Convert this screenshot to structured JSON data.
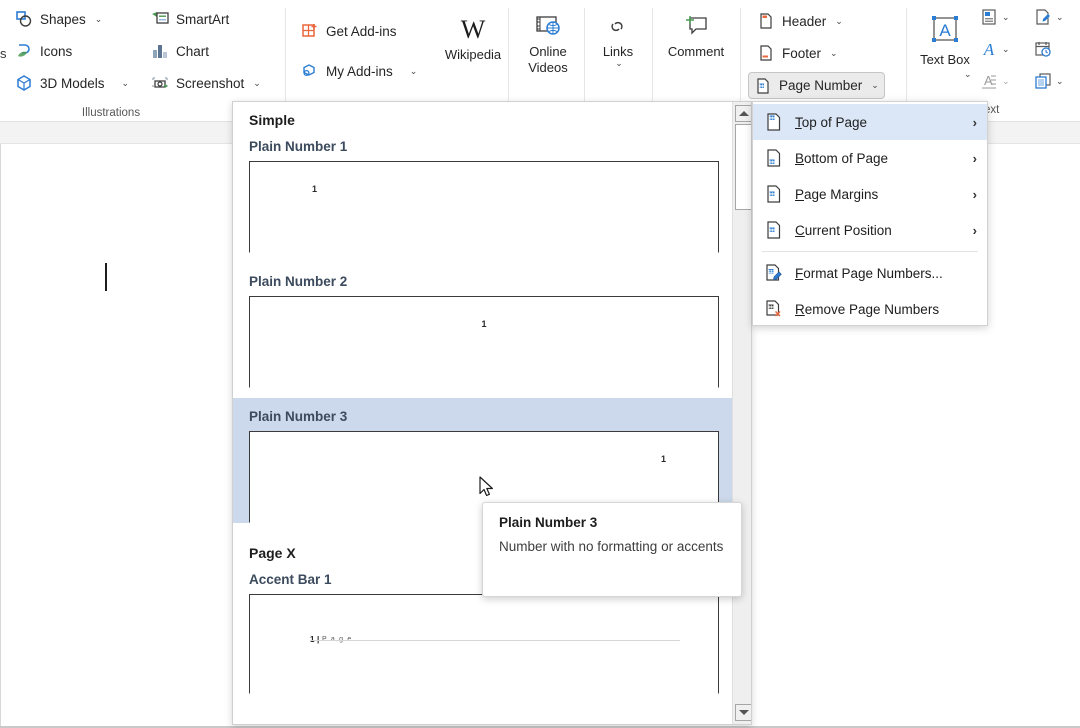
{
  "ribbon": {
    "truncated_left_text": "s",
    "groups": [
      {
        "name": "illustrations",
        "label": "Illustrations",
        "items": [
          {
            "label": "Shapes",
            "icon": "shapes-icon",
            "has_chevron": true,
            "chevron": "⌄"
          },
          {
            "label": "Icons",
            "icon": "icons-icon",
            "has_chevron": false,
            "chevron": ""
          },
          {
            "label": "3D Models",
            "icon": "3d-models-icon",
            "has_chevron": true,
            "chevron": "⌄"
          },
          {
            "label": "SmartArt",
            "icon": "smartart-icon",
            "has_chevron": false,
            "chevron": ""
          },
          {
            "label": "Chart",
            "icon": "chart-icon",
            "has_chevron": false,
            "chevron": ""
          },
          {
            "label": "Screenshot",
            "icon": "screenshot-icon",
            "has_chevron": true,
            "chevron": "⌄"
          }
        ]
      },
      {
        "name": "add-ins",
        "label": "",
        "items": [
          {
            "label": "Get Add-ins",
            "icon": "get-addins-icon",
            "has_chevron": false,
            "chevron": ""
          },
          {
            "label": "My Add-ins",
            "icon": "my-addins-icon",
            "has_chevron": true,
            "chevron": "⌄"
          }
        ],
        "big_buttons": [
          {
            "label": "Wikipedia",
            "icon": "wikipedia-icon"
          },
          {
            "label": "Online Videos",
            "icon": "online-videos-icon"
          },
          {
            "label": "Links",
            "icon": "links-icon",
            "chevron": "⌄"
          },
          {
            "label": "Comment",
            "icon": "comment-icon"
          }
        ]
      },
      {
        "name": "header-footer",
        "label": "",
        "items": [
          {
            "label": "Header",
            "icon": "header-icon",
            "has_chevron": true,
            "chevron": "⌄",
            "active": false
          },
          {
            "label": "Footer",
            "icon": "footer-icon",
            "has_chevron": true,
            "chevron": "⌄",
            "active": false
          },
          {
            "label": "Page Number",
            "icon": "page-number-icon",
            "has_chevron": true,
            "chevron": "⌄",
            "active": true
          }
        ]
      },
      {
        "name": "text",
        "label": "ext",
        "big_buttons": [
          {
            "label": "Text Box",
            "icon": "text-box-icon",
            "chevron": "⌄"
          }
        ],
        "small_icons": [
          {
            "name": "quick-parts-icon",
            "chevron": "⌄"
          },
          {
            "name": "signature-line-icon",
            "chevron": "⌄"
          },
          {
            "name": "wordart-icon",
            "chevron": "⌄"
          },
          {
            "name": "date-time-icon",
            "chevron": ""
          },
          {
            "name": "drop-cap-icon",
            "chevron": "⌄"
          },
          {
            "name": "object-icon",
            "chevron": "⌄"
          }
        ]
      }
    ]
  },
  "gallery": {
    "category": "Simple",
    "category2": "Page X",
    "items": [
      {
        "title": "Plain Number 1",
        "align": "left",
        "number": "1",
        "selected": false
      },
      {
        "title": "Plain Number 2",
        "align": "center",
        "number": "1",
        "selected": false
      },
      {
        "title": "Plain Number 3",
        "align": "right",
        "number": "1",
        "selected": true
      }
    ],
    "accent_items": [
      {
        "title": "Accent Bar 1",
        "number": "1",
        "divider": "|",
        "page_word": "P a g e"
      }
    ],
    "scrollbar": {
      "up_arrow": "▲",
      "down_arrow": "▼"
    }
  },
  "menu": {
    "items": [
      {
        "label": "Top of Page",
        "accel": "T",
        "icon": "top-of-page-icon",
        "submenu": true,
        "arrow": "›",
        "highlighted": true
      },
      {
        "label": "Bottom of Page",
        "accel": "B",
        "icon": "bottom-of-page-icon",
        "submenu": true,
        "arrow": "›",
        "highlighted": false
      },
      {
        "label": "Page Margins",
        "accel": "P",
        "icon": "page-margins-icon",
        "submenu": true,
        "arrow": "›",
        "highlighted": false
      },
      {
        "label": "Current Position",
        "accel": "C",
        "icon": "current-position-icon",
        "submenu": true,
        "arrow": "›",
        "highlighted": false
      },
      {
        "label": "Format Page Numbers...",
        "accel": "F",
        "icon": "format-page-numbers-icon",
        "submenu": false,
        "arrow": "",
        "highlighted": false
      },
      {
        "label": "Remove Page Numbers",
        "accel": "R",
        "icon": "remove-page-numbers-icon",
        "submenu": false,
        "arrow": "",
        "highlighted": false
      }
    ]
  },
  "tooltip": {
    "title": "Plain Number 3",
    "body": "Number with no formatting or accents"
  },
  "colors": {
    "selection_blue": "#ccd9ec",
    "menu_highlight": "#dbe7f6",
    "accent_blue": "#2b7cd3",
    "accent_orange": "#e8673c",
    "accent_green": "#4a9a54"
  }
}
